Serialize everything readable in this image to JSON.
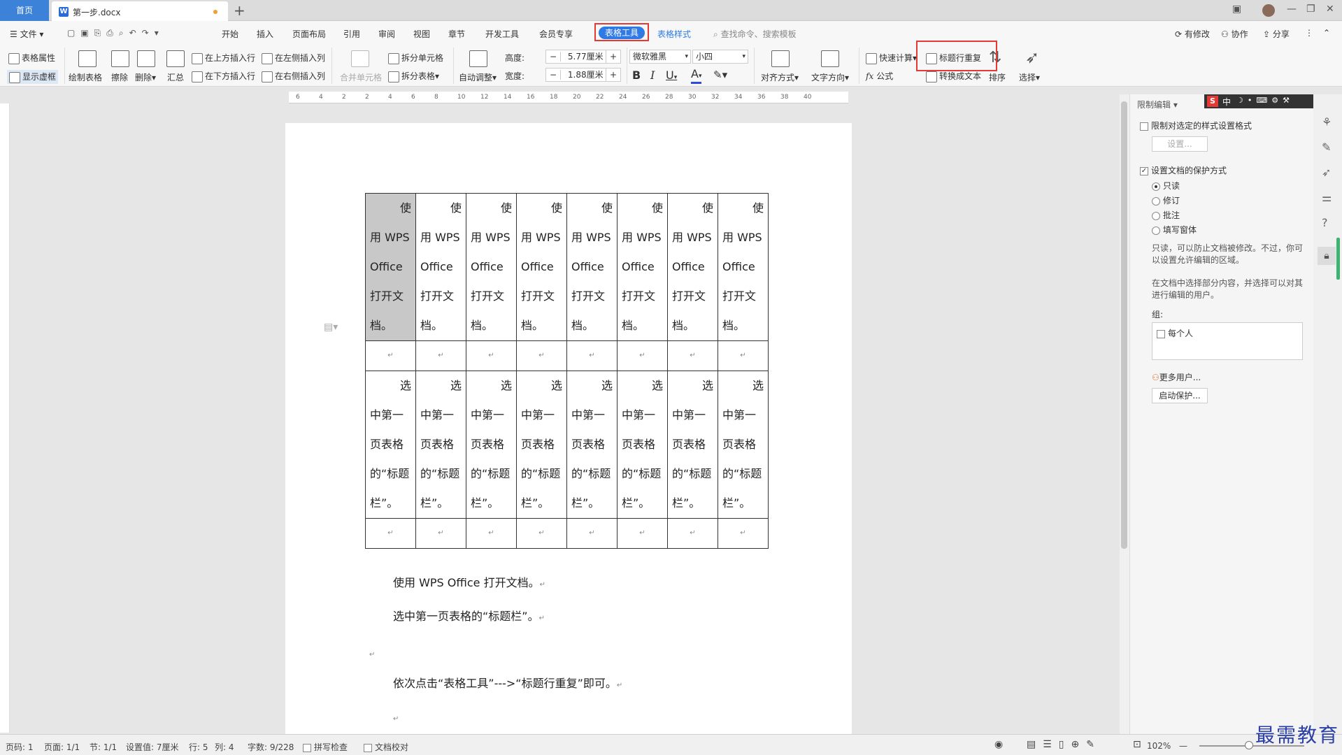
{
  "tabs": {
    "home": "首页",
    "doc_name": "第一步.docx",
    "new_tab": "+"
  },
  "menu": {
    "file": "文件",
    "items": [
      "开始",
      "插入",
      "页面布局",
      "引用",
      "审阅",
      "视图",
      "章节",
      "开发工具",
      "会员专享"
    ],
    "active": "表格工具",
    "table_style": "表格样式",
    "search_placeholder": "查找命令、搜索模板",
    "right": [
      "有修改",
      "协作",
      "分享"
    ]
  },
  "ribbon": {
    "table_props": "表格属性",
    "show_grid": "显示虚框",
    "draw_table": "绘制表格",
    "erase": "擦除",
    "delete": "删除",
    "summary": "汇总",
    "insert_above": "在上方插入行",
    "insert_below": "在下方插入行",
    "insert_left": "在左侧插入列",
    "insert_right": "在右侧插入列",
    "merge_cells": "合并单元格",
    "split_cells": "拆分单元格",
    "split_table": "拆分表格",
    "auto_fit": "自动调整",
    "height_label": "高度:",
    "height_value": "5.77厘米",
    "width_label": "宽度:",
    "width_value": "1.88厘米",
    "font_name": "微软雅黑",
    "font_size": "小四",
    "bold": "B",
    "italic": "I",
    "underline": "U",
    "font_color": "A",
    "align": "对齐方式",
    "text_direction": "文字方向",
    "quick_calc": "快速计算",
    "formula": "公式",
    "repeat_header": "标题行重复",
    "to_text": "转换成文本",
    "sort": "排序",
    "select": "选择"
  },
  "ruler_ticks": [
    "6",
    "4",
    "2",
    "2",
    "4",
    "6",
    "8",
    "10",
    "12",
    "14",
    "16",
    "18",
    "20",
    "22",
    "24",
    "26",
    "28",
    "30",
    "32",
    "34",
    "36",
    "38",
    "40"
  ],
  "document": {
    "row1_lines": [
      "使",
      "用 WPS",
      "Office",
      "打开文",
      "档。"
    ],
    "row3_lines": [
      "选",
      "中第一",
      "页表格",
      "的“标题",
      "栏”。"
    ],
    "columns": 8,
    "para1": "使用 WPS Office 打开文档。",
    "para2": "选中第一页表格的“标题栏”。",
    "para3": "依次点击“表格工具”--->“标题行重复”即可。",
    "para_mark": "↵"
  },
  "right_panel": {
    "title": "限制编辑",
    "limit_format": "限制对选定的样式设置格式",
    "settings_btn": "设置...",
    "protect_mode": "设置文档的保护方式",
    "options": [
      "只读",
      "修订",
      "批注",
      "填写窗体"
    ],
    "selected_option": "只读",
    "desc1": "只读，可以防止文档被修改。不过，你可以设置允许编辑的区域。",
    "desc2": "在文档中选择部分内容，并选择可以对其进行编辑的用户。",
    "group_label": "组:",
    "everyone": "每个人",
    "more_users": "更多用户...",
    "start_protect": "启动保护..."
  },
  "ime": {
    "label": "中"
  },
  "status": {
    "page_num": "页码: 1",
    "pages": "页面: 1/1",
    "section": "节: 1/1",
    "setting": "设置值: 7厘米",
    "row": "行: 5",
    "col": "列: 4",
    "words": "字数: 9/228",
    "spell": "拼写检查",
    "proof": "文档校对",
    "zoom": "102%"
  },
  "watermark": "最需教育",
  "colors": {
    "accent": "#2f7ae5",
    "highlight_red": "#e53935",
    "selected_cell": "#c8c8c8"
  }
}
